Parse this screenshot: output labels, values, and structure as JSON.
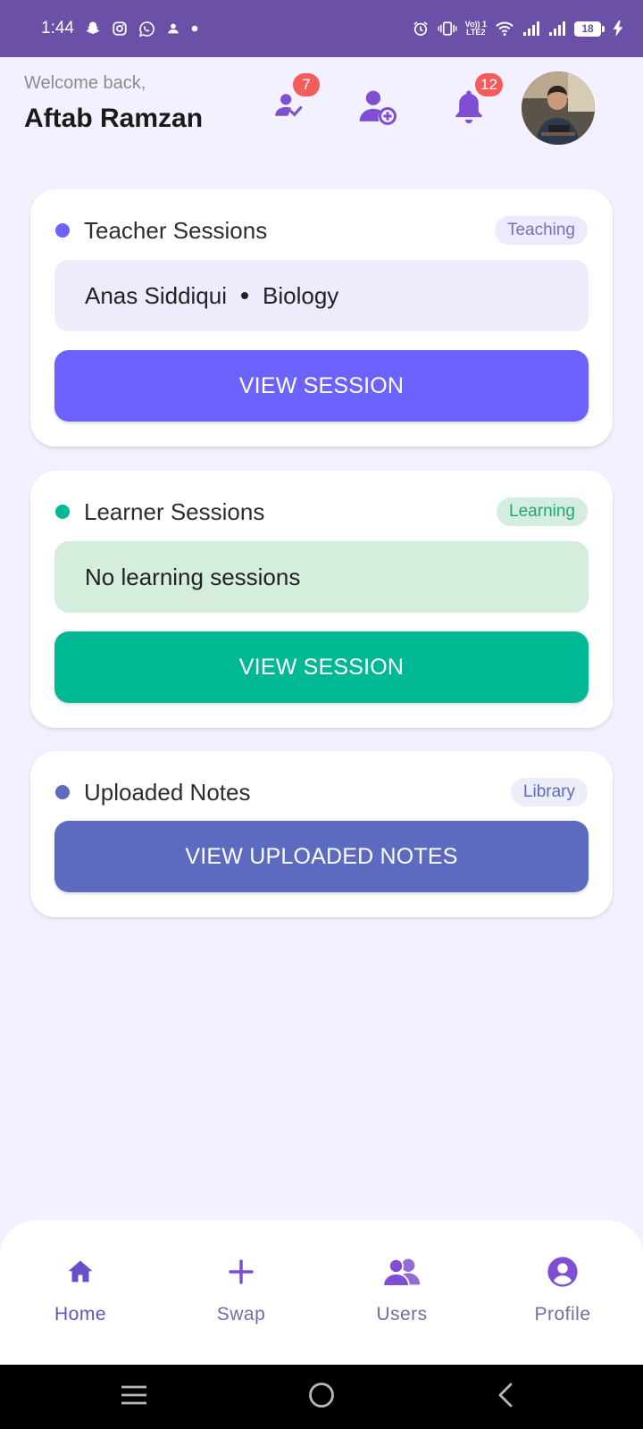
{
  "status_bar": {
    "time": "1:44",
    "battery": "18",
    "network_label_top": "Vo)) 1",
    "network_label_bottom": "LTE2"
  },
  "header": {
    "welcome_text": "Welcome back,",
    "user_name": "Aftab Ramzan",
    "requests_badge": "7",
    "notifications_badge": "12"
  },
  "cards": {
    "teacher": {
      "title": "Teacher Sessions",
      "tag": "Teaching",
      "teacher_name": "Anas Siddiqui",
      "subject": "Biology",
      "button": "VIEW SESSION"
    },
    "learner": {
      "title": "Learner Sessions",
      "tag": "Learning",
      "info": "No learning sessions",
      "button": "VIEW SESSION"
    },
    "notes": {
      "title": "Uploaded Notes",
      "tag": "Library",
      "button": "VIEW UPLOADED NOTES"
    }
  },
  "bottom_nav": {
    "items": [
      {
        "label": "Home",
        "icon": "home-icon",
        "active": true
      },
      {
        "label": "Swap",
        "icon": "plus-icon",
        "active": false
      },
      {
        "label": "Users",
        "icon": "users-icon",
        "active": false
      },
      {
        "label": "Profile",
        "icon": "account-circle-icon",
        "active": false
      }
    ]
  },
  "colors": {
    "status_bar": "#6a50a7",
    "background": "#f3f1ff",
    "accent_purple": "#6c63ff",
    "teal": "#00b894",
    "indigo": "#5c6bc0",
    "badge_red": "#f45b5b",
    "icon_purple": "#7e4fd3"
  }
}
